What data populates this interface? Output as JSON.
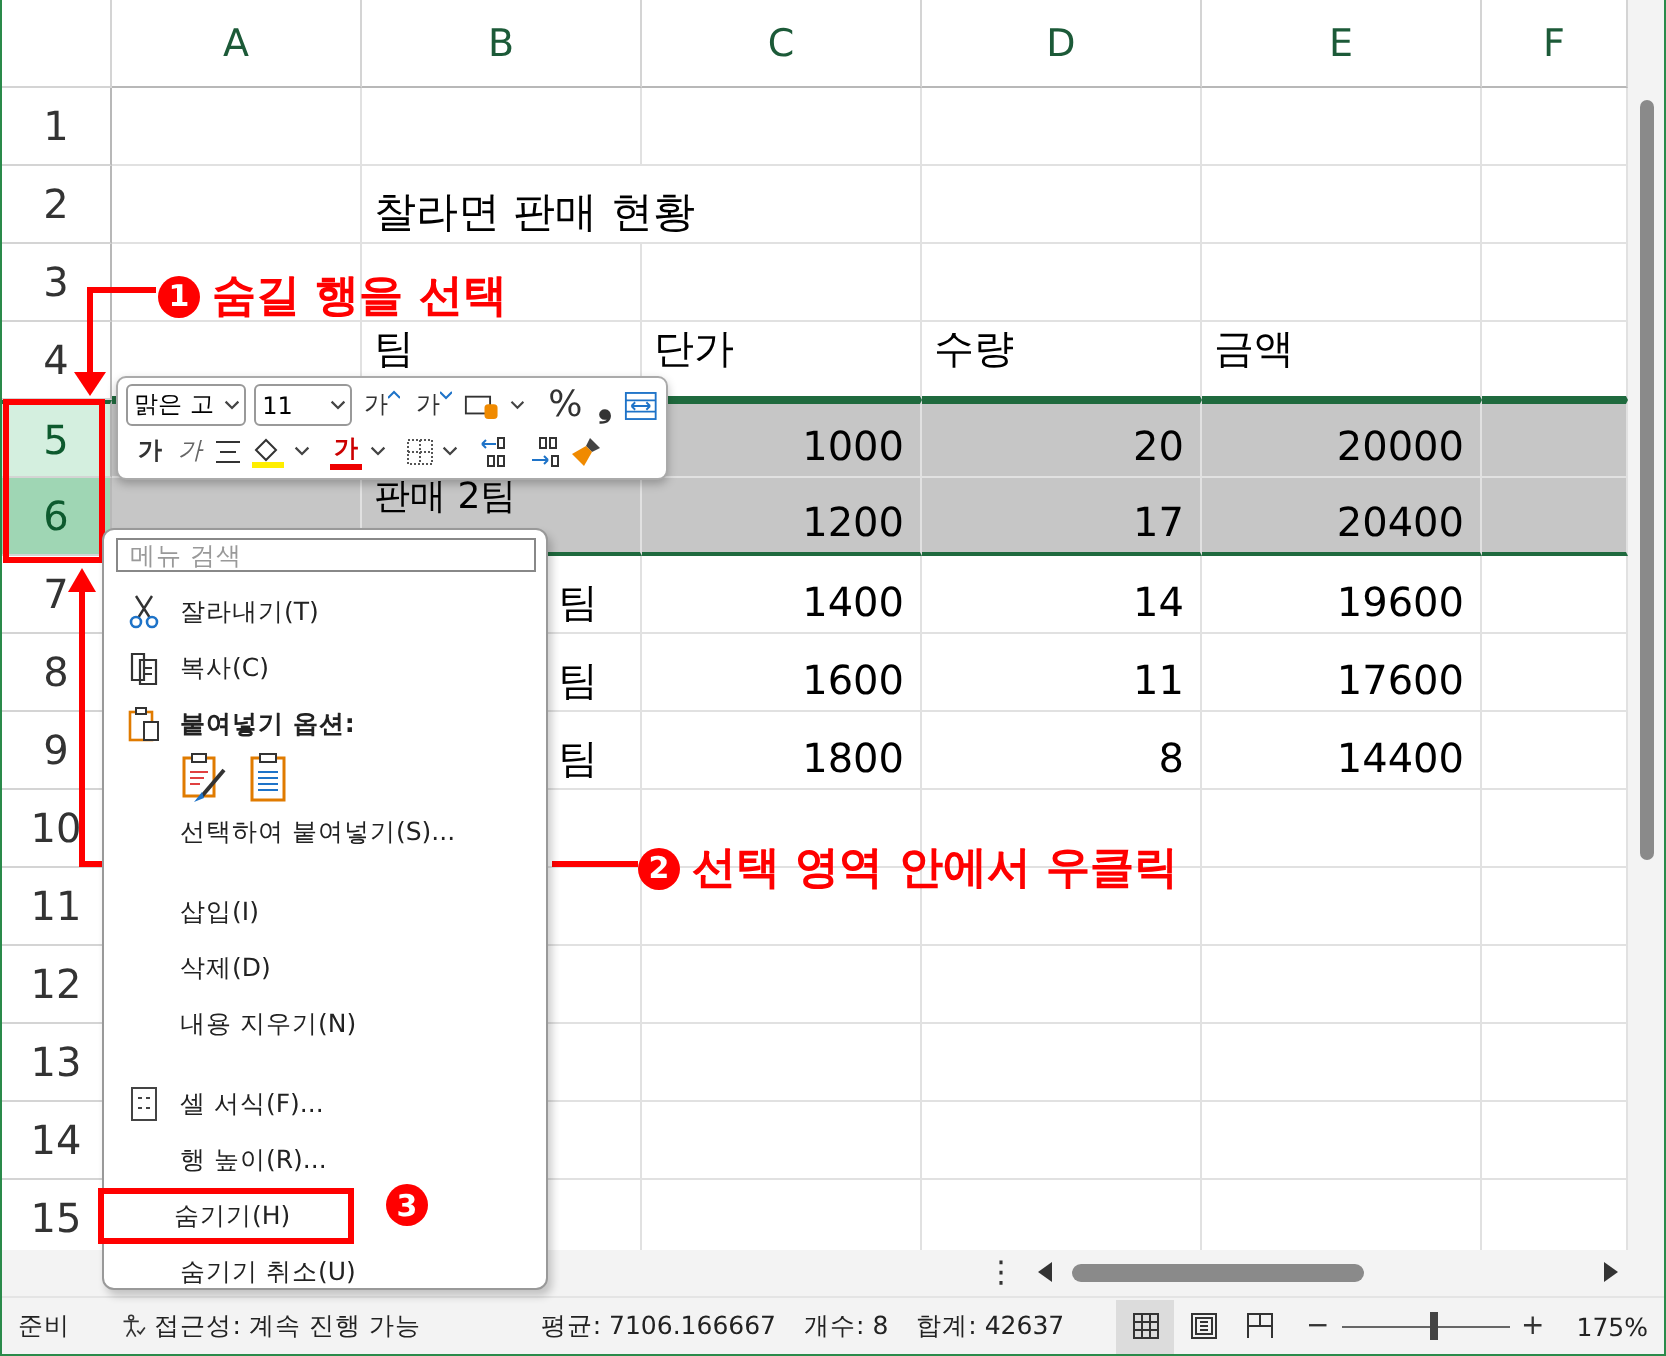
{
  "columns": [
    "A",
    "B",
    "C",
    "D",
    "E",
    "F"
  ],
  "rows": [
    {
      "header": "1",
      "selected": false,
      "active": false,
      "kind": "blank",
      "cells": {}
    },
    {
      "header": "2",
      "selected": false,
      "active": false,
      "kind": "title",
      "cells": {
        "B": "찰라면 판매 현황"
      }
    },
    {
      "header": "3",
      "selected": false,
      "active": false,
      "kind": "blank",
      "cells": {}
    },
    {
      "header": "4",
      "selected": false,
      "active": false,
      "kind": "head",
      "cells": {
        "B": "팀",
        "C": "단가",
        "D": "수량",
        "E": "금액"
      }
    },
    {
      "header": "5",
      "selected": true,
      "active": false,
      "kind": "data",
      "cut": false,
      "cells": {
        "C": "1000",
        "D": "20",
        "E": "20000"
      }
    },
    {
      "header": "6",
      "selected": true,
      "active": true,
      "kind": "data",
      "cut": false,
      "cells": {
        "B": "판매 2팀",
        "C": "1200",
        "D": "17",
        "E": "20400"
      }
    },
    {
      "header": "7",
      "selected": false,
      "active": false,
      "kind": "data",
      "cut": true,
      "cells": {
        "B": "팀",
        "C": "1400",
        "D": "14",
        "E": "19600"
      }
    },
    {
      "header": "8",
      "selected": false,
      "active": false,
      "kind": "data",
      "cut": true,
      "cells": {
        "B": "팀",
        "C": "1600",
        "D": "11",
        "E": "17600"
      }
    },
    {
      "header": "9",
      "selected": false,
      "active": false,
      "kind": "data",
      "cut": true,
      "cells": {
        "B": "팀",
        "C": "1800",
        "D": "8",
        "E": "14400"
      }
    },
    {
      "header": "10",
      "selected": false,
      "active": false,
      "kind": "blank",
      "cells": {}
    },
    {
      "header": "11",
      "selected": false,
      "active": false,
      "kind": "blank",
      "cells": {}
    },
    {
      "header": "12",
      "selected": false,
      "active": false,
      "kind": "blank",
      "cells": {}
    },
    {
      "header": "13",
      "selected": false,
      "active": false,
      "kind": "blank",
      "cells": {}
    },
    {
      "header": "14",
      "selected": false,
      "active": false,
      "kind": "blank",
      "cells": {}
    },
    {
      "header": "15",
      "selected": false,
      "active": false,
      "kind": "blank",
      "cells": {}
    }
  ],
  "mini_toolbar": {
    "font": "맑은 고",
    "size": "11",
    "grow": "가",
    "shrink": "가",
    "percent": "%",
    "comma": "❟",
    "bold": "가",
    "italic": "가",
    "font_color": "가"
  },
  "context_menu": {
    "search_placeholder": "메뉴 검색",
    "items": [
      {
        "kind": "item",
        "label": "잘라내기(T)",
        "highlighted": false
      },
      {
        "kind": "item",
        "label": "복사(C)",
        "highlighted": false
      },
      {
        "kind": "header",
        "label": "붙여넣기 옵션:",
        "highlighted": false
      },
      {
        "kind": "paste_icons"
      },
      {
        "kind": "item",
        "label": "선택하여 붙여넣기(S)...",
        "highlighted": false
      },
      {
        "kind": "separator"
      },
      {
        "kind": "item",
        "label": "삽입(I)",
        "highlighted": false
      },
      {
        "kind": "item",
        "label": "삭제(D)",
        "highlighted": false
      },
      {
        "kind": "item",
        "label": "내용 지우기(N)",
        "highlighted": false
      },
      {
        "kind": "separator"
      },
      {
        "kind": "item",
        "label": "셀 서식(F)...",
        "highlighted": false
      },
      {
        "kind": "item",
        "label": "행 높이(R)...",
        "highlighted": false
      },
      {
        "kind": "item",
        "label": "숨기기(H)",
        "highlighted": true
      },
      {
        "kind": "item",
        "label": "숨기기 취소(U)",
        "highlighted": false
      }
    ]
  },
  "annotations": [
    {
      "number": "1",
      "text": "숨길 행을 선택"
    },
    {
      "number": "2",
      "text": "선택 영역 안에서 우클릭"
    },
    {
      "number": "3"
    }
  ],
  "status_bar": {
    "mode": "준비",
    "accessibility": "접근성: 계속 진행 가능",
    "average": "평균: 7106.166667",
    "count": "개수: 8",
    "sum": "합계: 42637",
    "views": [
      {
        "selected": true
      },
      {
        "selected": false
      },
      {
        "selected": false
      }
    ],
    "zoom_minus": "−",
    "zoom_plus": "+",
    "zoom": {
      "level": 0.55
    },
    "zoom_label": "175%"
  },
  "scroll_dots": "⋮"
}
